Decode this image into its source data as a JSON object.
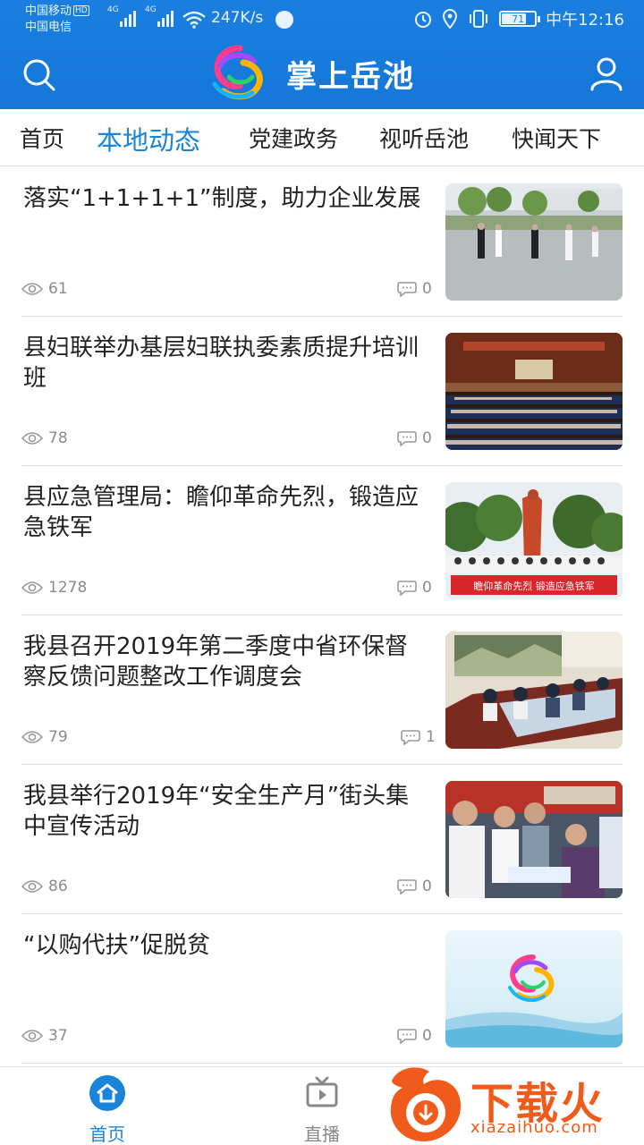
{
  "status_bar": {
    "carrier_1": "中国移动",
    "hd_badge": "HD",
    "carrier_2": "中国电信",
    "net_1": "4G",
    "net_2": "4G",
    "speed": "247K/s",
    "battery": "71",
    "time": "中午12:16"
  },
  "header": {
    "title": "掌上岳池"
  },
  "tabs": [
    {
      "label": "首页",
      "active": false
    },
    {
      "label": "本地动态",
      "active": true
    },
    {
      "label": "党建政务",
      "active": false
    },
    {
      "label": "视听岳池",
      "active": false
    },
    {
      "label": "快闻天下",
      "active": false
    }
  ],
  "articles": [
    {
      "title": "落实“1+1+1+1”制度，助力企业发展",
      "views": "61",
      "comments": "0"
    },
    {
      "title": "县妇联举办基层妇联执委素质提升培训班",
      "views": "78",
      "comments": "0"
    },
    {
      "title": "县应急管理局：瞻仰革命先烈，锻造应急铁军",
      "views": "1278",
      "comments": "0"
    },
    {
      "title": "我县召开2019年第二季度中省环保督察反馈问题整改工作调度会",
      "views": "79",
      "comments": "1"
    },
    {
      "title": " 我县举行2019年“安全生产月”街头集中宣传活动",
      "views": "86",
      "comments": "0"
    },
    {
      "title": "“以购代扶”促脱贫",
      "views": "37",
      "comments": "0"
    }
  ],
  "thumb_banner_text": "瞻仰革命先烈  锻造应急铁军",
  "bottom_nav": {
    "home": "首页",
    "live": "直播"
  },
  "watermark": {
    "text": "下载火",
    "url": "xiazaihuo.com"
  },
  "colors": {
    "header_blue": "#1a7fe0",
    "active_tab": "#1a84d8",
    "watermark_orange": "#f05a1a"
  }
}
